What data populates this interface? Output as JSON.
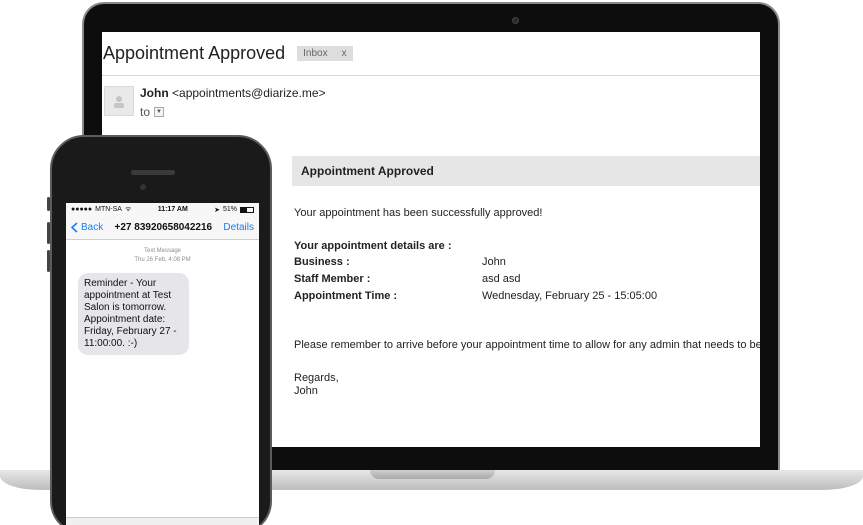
{
  "email": {
    "subject": "Appointment Approved",
    "label": "Inbox",
    "label_close": "x",
    "sender_name": "John",
    "sender_email": "<appointments@diarize.me>",
    "to_label": "to",
    "banner_title": "Appointment Approved",
    "intro": "Your appointment has been successfully approved!",
    "details_heading": "Your appointment details are :",
    "details": [
      {
        "label": "Business :",
        "value": "John"
      },
      {
        "label": "Staff Member :",
        "value": "asd asd"
      },
      {
        "label": "Appointment Time :",
        "value": "Wednesday, February 25 - 15:05:00"
      }
    ],
    "reminder": "Please remember to arrive before your appointment time to allow for any admin that needs to be done.",
    "signoff": "Regards,",
    "signature": "John"
  },
  "phone": {
    "carrier": "MTN-SA",
    "time": "11:17 AM",
    "battery": "51%",
    "back_label": "Back",
    "contact": "+27 83920658042216",
    "details_label": "Details",
    "meta_type": "Text Message",
    "meta_date": "Thu 26 Feb, 4:08 PM",
    "message": "Reminder - Your appointment at Test Salon is tomorrow. Appointment date: Friday, February 27 - 11:00:00. :-)"
  }
}
